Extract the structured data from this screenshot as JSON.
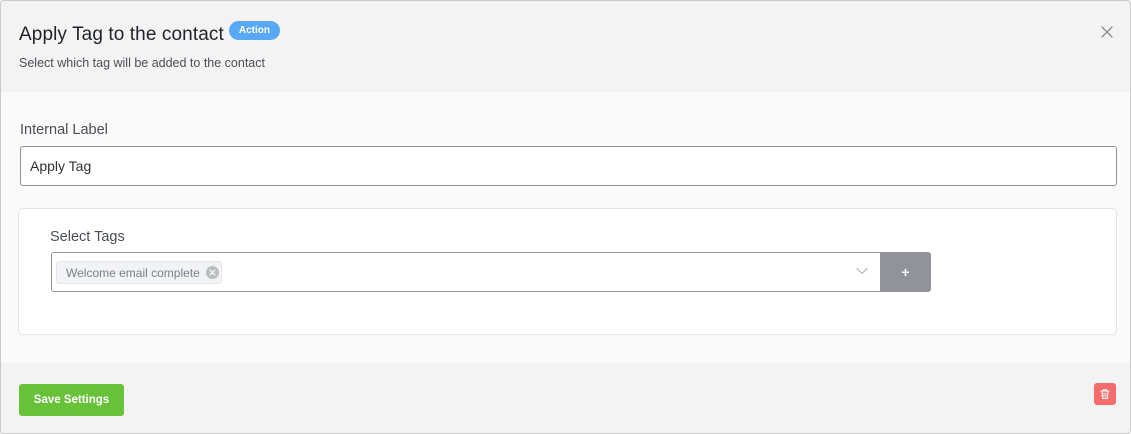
{
  "header": {
    "title": "Apply Tag to the contact",
    "badge": "Action",
    "subtitle": "Select which tag will be added to the contact",
    "close_icon": "close-icon"
  },
  "internal_label": {
    "label": "Internal Label",
    "value": "Apply Tag"
  },
  "tags": {
    "label": "Select Tags",
    "selected": [
      "Welcome email complete"
    ],
    "chip_remove_icon": "circle-close-icon",
    "dropdown_icon": "chevron-down-icon",
    "add_label": "+"
  },
  "footer": {
    "save_label": "Save Settings",
    "delete_icon": "trash-icon"
  },
  "colors": {
    "badge": "#58a8f5",
    "save_button": "#67c23a",
    "delete_button": "#f56c6c",
    "add_button": "#909399"
  }
}
